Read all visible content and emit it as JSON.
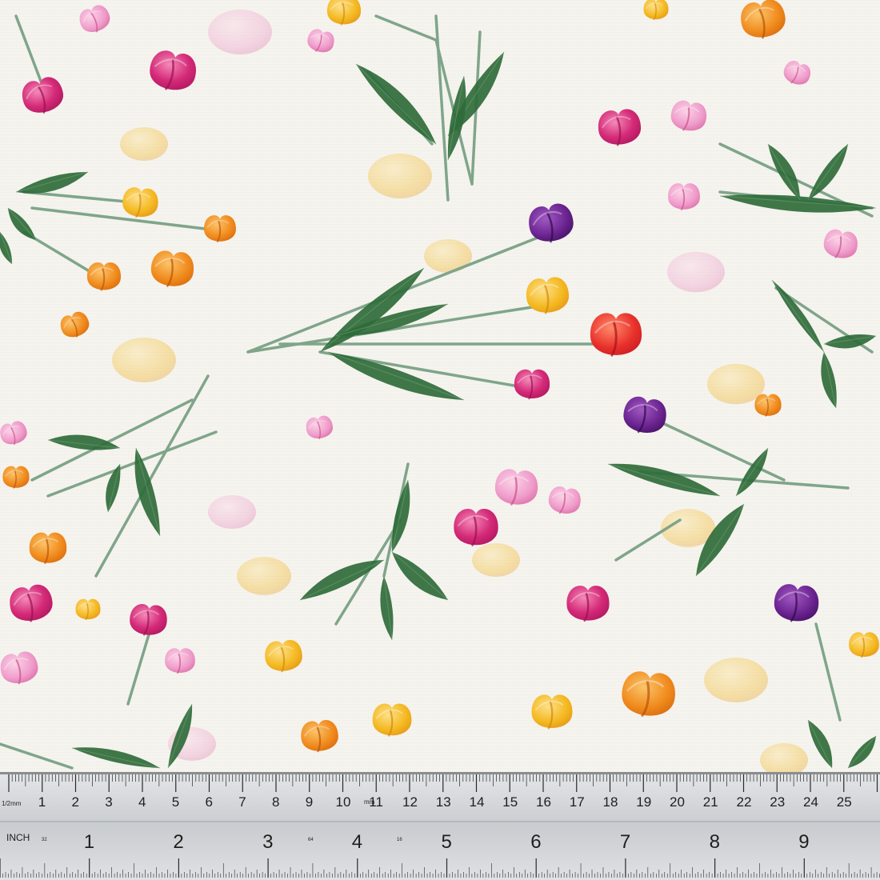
{
  "image": {
    "subject": "tulip-print fabric swatch with ruler",
    "background_color": "#f6f4ef",
    "palette": {
      "magenta": "#d42a78",
      "pink": "#ef9ccb",
      "purple": "#5a1f7a",
      "orange": "#f08a1c",
      "yellow": "#f4b81f",
      "red": "#e8302a",
      "leaf": "#2f6b3a",
      "stem": "#7fa58a"
    }
  },
  "ruler": {
    "mm_label": "1/2mm",
    "mm_unit": "mm",
    "cm_numbers": [
      "1",
      "2",
      "3",
      "4",
      "5",
      "6",
      "7",
      "8",
      "9",
      "10",
      "11",
      "12",
      "13",
      "14",
      "15",
      "16",
      "17",
      "18",
      "19",
      "20",
      "21",
      "22",
      "23",
      "24",
      "25"
    ],
    "inch_label": "INCH",
    "inch_fraction_32": "32",
    "inch_fraction_64": "64",
    "inch_fraction_16": "16",
    "inch_numbers": [
      "1",
      "2",
      "3",
      "4",
      "5",
      "6",
      "7",
      "8",
      "9"
    ]
  }
}
